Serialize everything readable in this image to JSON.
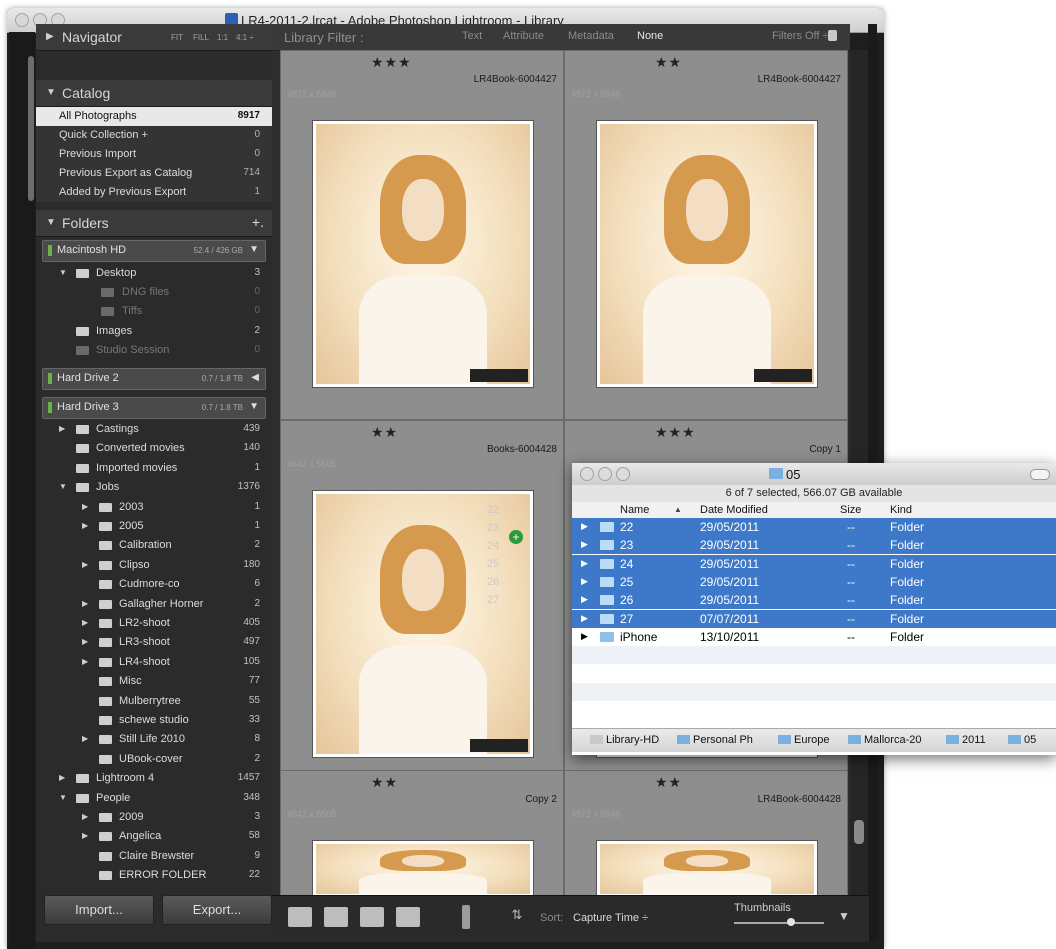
{
  "window": {
    "title": "LR4-2011-2.lrcat - Adobe Photoshop Lightroom - Library"
  },
  "navigator": {
    "label": "Navigator",
    "options": [
      "FIT",
      "FILL",
      "1:1",
      "4:1 ÷"
    ]
  },
  "catalog": {
    "label": "Catalog",
    "items": [
      {
        "label": "All Photographs",
        "count": "8917"
      },
      {
        "label": "Quick Collection +",
        "count": "0"
      },
      {
        "label": "Previous Import",
        "count": "0"
      },
      {
        "label": "Previous Export as Catalog",
        "count": "714"
      },
      {
        "label": "Added by Previous Export",
        "count": "1"
      }
    ]
  },
  "folders": {
    "label": "Folders",
    "add": "+.",
    "volumes": [
      {
        "name": "Macintosh HD",
        "size": "52.4 / 426 GB"
      },
      {
        "name": "Hard Drive 2",
        "size": "0.7 / 1.8 TB"
      },
      {
        "name": "Hard Drive 3",
        "size": "0.7 / 1.8 TB"
      }
    ],
    "mac_items": [
      {
        "label": "Desktop",
        "count": "3"
      },
      {
        "label": "DNG files",
        "count": "0"
      },
      {
        "label": "Tiffs",
        "count": "0"
      },
      {
        "label": "Images",
        "count": "2"
      },
      {
        "label": "Studio Session",
        "count": "0"
      }
    ],
    "hd3_items": [
      {
        "label": "Castings",
        "count": "439"
      },
      {
        "label": "Converted movies",
        "count": "140"
      },
      {
        "label": "Imported movies",
        "count": "1"
      },
      {
        "label": "Jobs",
        "count": "1376"
      },
      {
        "label": "2003",
        "count": "1"
      },
      {
        "label": "2005",
        "count": "1"
      },
      {
        "label": "Calibration",
        "count": "2"
      },
      {
        "label": "Clipso",
        "count": "180"
      },
      {
        "label": "Cudmore-co",
        "count": "6"
      },
      {
        "label": "Gallagher Horner",
        "count": "2"
      },
      {
        "label": "LR2-shoot",
        "count": "405"
      },
      {
        "label": "LR3-shoot",
        "count": "497"
      },
      {
        "label": "LR4-shoot",
        "count": "105"
      },
      {
        "label": "Misc",
        "count": "77"
      },
      {
        "label": "Mulberrytree",
        "count": "55"
      },
      {
        "label": "schewe studio",
        "count": "33"
      },
      {
        "label": "Still Life 2010",
        "count": "8"
      },
      {
        "label": "UBook-cover",
        "count": "2"
      },
      {
        "label": "Lightroom 4",
        "count": "1457"
      },
      {
        "label": "People",
        "count": "348"
      },
      {
        "label": "2009",
        "count": "3"
      },
      {
        "label": "Angelica",
        "count": "58"
      },
      {
        "label": "Claire Brewster",
        "count": "9"
      },
      {
        "label": "ERROR FOLDER",
        "count": "22"
      }
    ]
  },
  "buttons": {
    "import": "Import...",
    "export": "Export..."
  },
  "filter": {
    "label": "Library Filter :",
    "text": "Text",
    "attribute": "Attribute",
    "metadata": "Metadata",
    "none": "None",
    "filters_off": "Filters Off ÷"
  },
  "grid": [
    {
      "stars": "★★★",
      "name": "LR4Book-6004427",
      "dims": "4872 x 5846"
    },
    {
      "stars": "★★",
      "name": "LR4Book-6004427",
      "dims": "4872 x 5846"
    },
    {
      "stars": "★★",
      "name": "Books-6004428",
      "dims": "4642 x 5505"
    },
    {
      "stars": "★★★",
      "name": "Copy 1",
      "dims": ""
    },
    {
      "stars": "★★",
      "name": "Copy 2",
      "dims": "4642 x 5505"
    },
    {
      "stars": "★★",
      "name": "LR4Book-6004428",
      "dims": "4872 x 5846"
    }
  ],
  "drag_ghost": [
    "22",
    "23",
    "24",
    "25",
    "26",
    "27"
  ],
  "toolbar": {
    "sort_label": "Sort:",
    "sort_value": "Capture Time ÷",
    "thumbnails": "Thumbnails"
  },
  "finder": {
    "title": "05",
    "status": "6 of 7 selected, 566.07 GB available",
    "columns": [
      "Name",
      "Date Modified",
      "Size",
      "Kind"
    ],
    "rows": [
      {
        "name": "22",
        "date": "29/05/2011",
        "size": "--",
        "kind": "Folder"
      },
      {
        "name": "23",
        "date": "29/05/2011",
        "size": "--",
        "kind": "Folder"
      },
      {
        "name": "24",
        "date": "29/05/2011",
        "size": "--",
        "kind": "Folder"
      },
      {
        "name": "25",
        "date": "29/05/2011",
        "size": "--",
        "kind": "Folder"
      },
      {
        "name": "26",
        "date": "29/05/2011",
        "size": "--",
        "kind": "Folder"
      },
      {
        "name": "27",
        "date": "07/07/2011",
        "size": "--",
        "kind": "Folder"
      },
      {
        "name": "iPhone",
        "date": "13/10/2011",
        "size": "--",
        "kind": "Folder"
      }
    ],
    "path": [
      "Library-HD",
      "Personal Ph",
      "Europe",
      "Mallorca-20",
      "2011",
      "05"
    ]
  }
}
